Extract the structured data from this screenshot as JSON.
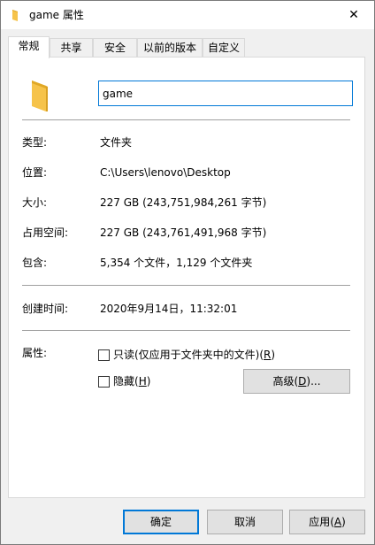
{
  "window": {
    "title": "game 属性",
    "close_glyph": "✕"
  },
  "tabs": [
    {
      "label": "常规",
      "active": true
    },
    {
      "label": "共享"
    },
    {
      "label": "安全"
    },
    {
      "label": "以前的版本"
    },
    {
      "label": "自定义"
    }
  ],
  "general": {
    "name_value": "game",
    "rows": [
      {
        "label": "类型:",
        "value": "文件夹"
      },
      {
        "label": "位置:",
        "value": "C:\\Users\\lenovo\\Desktop"
      },
      {
        "label": "大小:",
        "value": "227 GB (243,751,984,261 字节)"
      },
      {
        "label": "占用空间:",
        "value": "227 GB (243,761,491,968 字节)"
      },
      {
        "label": "包含:",
        "value": "5,354 个文件，1,129 个文件夹"
      }
    ],
    "created": {
      "label": "创建时间:",
      "value": "2020年9月14日，11:32:01"
    },
    "attributes": {
      "label": "属性:",
      "readonly": {
        "text": "只读(仅应用于文件夹中的文件)(",
        "key": "R",
        "close": ")",
        "checked": false
      },
      "hidden": {
        "text": "隐藏(",
        "key": "H",
        "close": ")",
        "checked": false
      },
      "advanced": {
        "text": "高级(",
        "key": "D",
        "close": ")..."
      }
    }
  },
  "footer": {
    "ok": "确定",
    "cancel": "取消",
    "apply": {
      "text": "应用(",
      "key": "A",
      "close": ")"
    }
  },
  "colors": {
    "accent": "#0078d7",
    "folder": "#f6c34a",
    "folder_dark": "#e0a826"
  }
}
